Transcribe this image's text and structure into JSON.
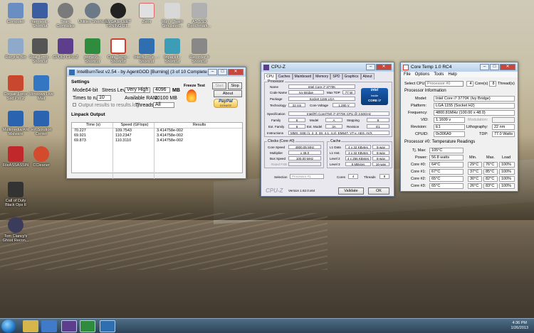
{
  "desktop": {
    "icons": [
      {
        "label": "Computer",
        "color": "#6a8ec2"
      },
      {
        "label": "memtestj - Shortcut",
        "color": "#3c5ea0"
      },
      {
        "label": "Team Comrades",
        "color": "#7a7a7a"
      },
      {
        "label": "Utilities Shortcut",
        "color": "#6c7a88"
      },
      {
        "label": "EVGA E-LEET TUNING UT...",
        "color": "#222"
      },
      {
        "label": "Zenx",
        "color": "#e0e0e0"
      },
      {
        "label": "Run # Team Simulated...",
        "color": "#d8d8d8"
      },
      {
        "label": "AS SSD Benchmark...",
        "color": "#b0b0b0"
      },
      {
        "label": "Recycle Bin",
        "color": "#8ea9c9"
      },
      {
        "label": "Real Temp - Shortcut",
        "color": "#555"
      },
      {
        "label": "CPUID CPU-Z",
        "color": "#5d3e8c"
      },
      {
        "label": "prime95 - Shortcut",
        "color": "#2f8c3f"
      },
      {
        "label": "Core Temp - Shortcut",
        "color": "#d23d2d"
      },
      {
        "label": "IntelBurnTe... - Shortcut",
        "color": "#2f6fb0"
      },
      {
        "label": "linpackIt - Shortcut",
        "color": "#3d9db7"
      },
      {
        "label": "Recorder # Shortcut",
        "color": "#888"
      },
      {
        "label": "Corsair Force Ssd Pro 2",
        "color": "#c9472f"
      },
      {
        "label": "Windows Live Mail",
        "color": "#3476c2"
      },
      {
        "label": "Multimedia/Ant Malware",
        "color": "#2a63b0"
      },
      {
        "label": "HP Solution Center",
        "color": "#2a63b0"
      },
      {
        "label": "FileASSASSIN",
        "color": "#c0282b"
      },
      {
        "label": "CCleaner",
        "color": "#d34a2c"
      },
      {
        "label": "Call of Duty Black Ops II",
        "color": "#333"
      },
      {
        "label": "Tom Clancy's Ghost Recon...",
        "color": "#3b3b5c"
      }
    ]
  },
  "ibt": {
    "title": "IntelBurnTest v2.54 - by AgentGOD [Burning] (3 of 10 Completed)",
    "settings_label": "Settings",
    "mode_label": "Mode:",
    "mode_value": "64-bit",
    "stress_label": "Stress Level:",
    "stress_value": "Very High",
    "mem_value": "4096",
    "mem_unit": "MB",
    "times_label": "Times to run:",
    "times_value": "10",
    "ram_label": "Available RAM:",
    "ram_value": "10100 MB",
    "threads_label": "Threads:",
    "threads_value": "All",
    "output_label": "Output results to results.log",
    "start_label": "Start",
    "stop_label": "Stop",
    "about_label": "About",
    "freeze_label": "Freeze Test",
    "paypal_label": "PayPal",
    "donate_label": "DONATE",
    "linpack_label": "Linpack Output",
    "columns": [
      "Time (s)",
      "Speed (GFlops)",
      "Results"
    ],
    "rows": [
      [
        "70.227",
        "109.7543",
        "3.414758e-002"
      ],
      [
        "69.921",
        "110.2347",
        "3.414758e-002"
      ],
      [
        "69.873",
        "110.3110",
        "3.414758e-002"
      ]
    ]
  },
  "cpuz": {
    "title": "CPU-Z",
    "tabs": [
      "CPU",
      "Caches",
      "Mainboard",
      "Memory",
      "SPD",
      "Graphics",
      "About"
    ],
    "processor_legend": "Processor",
    "name_label": "Name",
    "name_value": "Intel Core i7 3770K",
    "codename_label": "Code Name",
    "codename_value": "Ivy Bridge",
    "maxtdp_label": "Max TDP",
    "maxtdp_value": "77 W",
    "package_label": "Package",
    "package_value": "Socket 1155 LGA",
    "tech_label": "Technology",
    "tech_value": "22 nm",
    "voltage_label": "Core Voltage",
    "voltage_value": "1.280 V",
    "spec_label": "Specification",
    "spec_value": "Intel(R) Core(TM) i7-3770K CPU @ 3.50GHz",
    "family_label": "Family",
    "family_value": "6",
    "model_label": "Model",
    "model_value": "A",
    "stepping_label": "Stepping",
    "stepping_value": "9",
    "extfam_label": "Ext. Family",
    "extfam_value": "6",
    "extmodel_label": "Ext. Model",
    "extmodel_value": "3A",
    "revision_label": "Revision",
    "revision_value": "E1",
    "instr_label": "Instructions",
    "instr_value": "MMX, SSE (1, 2, 3, 3S, 4.1, 4.2), EM64T, VT-x, AES, AVX",
    "clocks_legend": "Clocks (Core #0)",
    "corespeed_label": "Core Speed",
    "corespeed_value": "4800.05 MHz",
    "mult_label": "Multiplier",
    "mult_value": "x 48.0",
    "bus_label": "Bus Speed",
    "bus_value": "100.00 MHz",
    "ratedfsb_label": "Rated FSB",
    "cache_legend": "Cache",
    "l1d_label": "L1 Data",
    "l1d_value": "4 x 32 KBytes",
    "l1d_way": "8-way",
    "l1i_label": "L1 Inst.",
    "l1i_value": "4 x 32 KBytes",
    "l1i_way": "8-way",
    "l2_label": "Level 2",
    "l2_value": "4 x 256 KBytes",
    "l2_way": "8-way",
    "l3_label": "Level 3",
    "l3_value": "8 MBytes",
    "l3_way": "16-way",
    "selection_label": "Selection",
    "selection_value": "Processor #1",
    "cores_label": "Cores",
    "cores_value": "4",
    "threads_label": "Threads",
    "threads_value": "8",
    "logo": "CPU-Z",
    "version": "Version 1.62.0.x64",
    "validate_label": "Validate",
    "ok_label": "OK",
    "intel_text_1": "intel",
    "intel_text_2": "inside",
    "intel_text_3": "CORE i7"
  },
  "coretemp": {
    "title": "Core Temp 1.0 RC4",
    "menu": [
      "File",
      "Options",
      "Tools",
      "Help"
    ],
    "select_cpu_label": "Select CPU:",
    "select_cpu_value": "Processor #0",
    "cores_value": "4",
    "cores_label": "Core(s)",
    "threads_value": "8",
    "threads_label": "Thread(s)",
    "proc_info_label": "Processor Information",
    "model_label": "Model:",
    "model_value": "Intel Core i7 3770K (Ivy Bridge)",
    "platform_label": "Platform:",
    "platform_value": "LGA 1155 (Socket H2)",
    "freq_label": "Frequency:",
    "freq_value": "4800.81MHz (100.00 x 48.0)",
    "vid_label": "VID:",
    "vid_value": "1.1609 v",
    "modulation_label": "Modulation:",
    "revision_label": "Revision:",
    "revision_value": "E1",
    "litho_label": "Lithography:",
    "litho_value": "22 nm",
    "cpuid_label": "CPUID:",
    "cpuid_value": "0x306A9",
    "tdp_label": "TDP:",
    "tdp_value": "77.0 Watts",
    "readings_label": "Processor #0: Temperature Readings",
    "tjmax_label": "Tj. Max:",
    "tjmax_value": "105°C",
    "power_label": "Power:",
    "power_value": "56.8 watts",
    "cols": [
      "Min.",
      "Max.",
      "Load"
    ],
    "cores": [
      {
        "label": "Core #0:",
        "temp": "64°C",
        "min": "29°C",
        "max": "76°C",
        "load": "100%"
      },
      {
        "label": "Core #1:",
        "temp": "67°C",
        "min": "37°C",
        "max": "85°C",
        "load": "100%"
      },
      {
        "label": "Core #2:",
        "temp": "65°C",
        "min": "30°C",
        "max": "82°C",
        "load": "100%"
      },
      {
        "label": "Core #3:",
        "temp": "65°C",
        "min": "26°C",
        "max": "83°C",
        "load": "100%"
      }
    ]
  },
  "taskbar": {
    "time": "4:36 PM",
    "date": "1/26/2013"
  }
}
